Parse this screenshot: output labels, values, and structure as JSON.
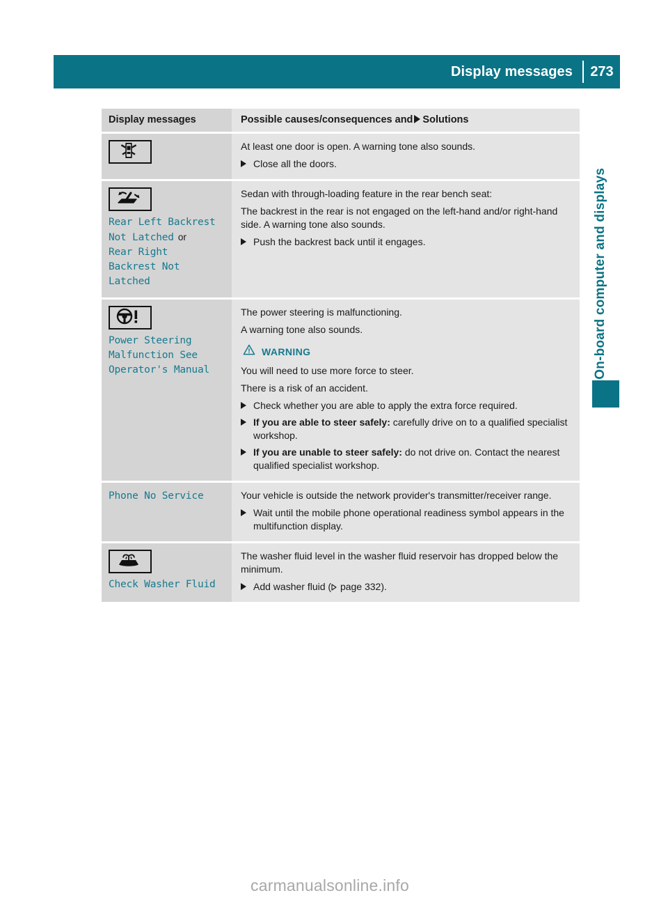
{
  "header": {
    "title": "Display messages",
    "page_number": "273"
  },
  "side_tab": {
    "label": "On-board computer and displays"
  },
  "table": {
    "columns": {
      "left": "Display messages",
      "right_prefix": "Possible causes/consequences and",
      "right_suffix": "Solutions"
    },
    "rows": [
      {
        "icon": "car-doors-open-icon",
        "message": "",
        "body": [
          "At least one door is open. A warning tone also sounds.",
          "Close all the doors."
        ]
      },
      {
        "icon": "rear-backrest-fold-icon",
        "message_line1": "Rear Left Backrest",
        "message_line2": "Not Latched",
        "message_or": "or",
        "message_line3": "Rear Right",
        "message_line4": "Backrest Not",
        "message_line5": "Latched",
        "body": [
          "Sedan with through-loading feature in the rear bench seat:",
          "The backrest in the rear is not engaged on the left-hand and/or right-hand side. A warning tone also sounds.",
          "Push the backrest back until it engages."
        ]
      },
      {
        "icon": "steering-wheel-warning-icon",
        "message_line1": "Power Steering",
        "message_line2": "Malfunction See",
        "message_line3": "Operator's Manual",
        "body": {
          "p1": "The power steering is malfunctioning.",
          "p2": "A warning tone also sounds.",
          "warning_label": "WARNING",
          "p3": "You will need to use more force to steer.",
          "p4": "There is a risk of an accident.",
          "b1": "Check whether you are able to apply the extra force required.",
          "b2_bold": "If you are able to steer safely:",
          "b2_rest": " carefully drive on to a qualified specialist workshop.",
          "b3_bold": "If you are unable to steer safely:",
          "b3_rest": " do not drive on. Contact the nearest qualified specialist workshop."
        }
      },
      {
        "icon": "",
        "message_line1": "Phone No Service",
        "body": {
          "p1": "Your vehicle is outside the network provider's transmitter/receiver range.",
          "b1": "Wait until the mobile phone operational readiness symbol appears in the multifunction display."
        }
      },
      {
        "icon": "washer-fluid-icon",
        "message_line1": "Check Washer Fluid",
        "body": {
          "p1": "The washer fluid level in the washer fluid reservoir has dropped below the minimum.",
          "b1_pre": "Add washer fluid (",
          "b1_page": " page 332",
          "b1_post": ")."
        }
      }
    ]
  },
  "watermark": "carmanualsonline.info",
  "colors": {
    "accent_teal": "#0b7386",
    "message_teal": "#17798e",
    "left_cell_bg": "#d4d4d4",
    "right_cell_bg": "#e4e4e4"
  }
}
